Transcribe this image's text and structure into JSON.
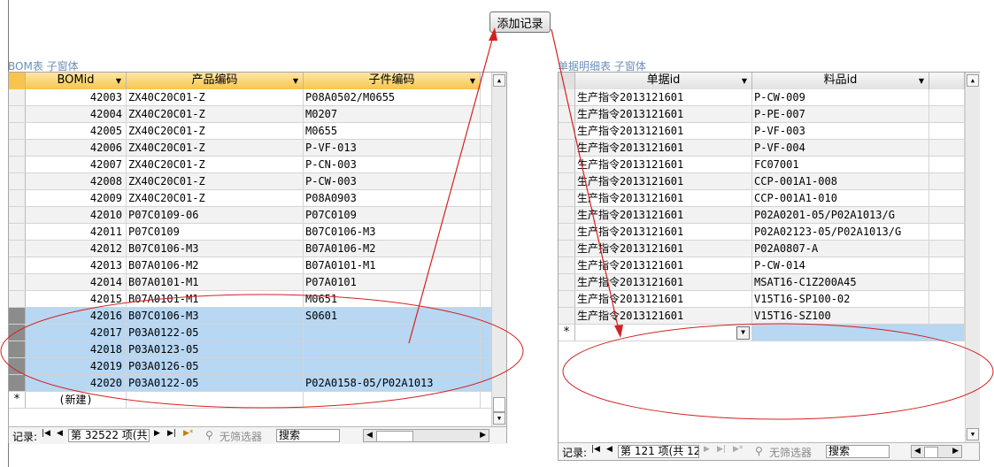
{
  "add_button_label": "添加记录",
  "bom": {
    "caption": "BOM表 子窗体",
    "columns": [
      "BOMid",
      "产品编码",
      "子件编码"
    ],
    "rows": [
      [
        "42003",
        "ZX40C20C01-Z",
        "P08A0502/M0655"
      ],
      [
        "42004",
        "ZX40C20C01-Z",
        "M0207"
      ],
      [
        "42005",
        "ZX40C20C01-Z",
        "M0655"
      ],
      [
        "42006",
        "ZX40C20C01-Z",
        "P-VF-013"
      ],
      [
        "42007",
        "ZX40C20C01-Z",
        "P-CN-003"
      ],
      [
        "42008",
        "ZX40C20C01-Z",
        "P-CW-003"
      ],
      [
        "42009",
        "ZX40C20C01-Z",
        "P08A0903"
      ],
      [
        "42010",
        "P07C0109-06",
        "P07C0109"
      ],
      [
        "42011",
        "P07C0109",
        "B07C0106-M3"
      ],
      [
        "42012",
        "B07C0106-M3",
        "B07A0106-M2"
      ],
      [
        "42013",
        "B07A0106-M2",
        "B07A0101-M1"
      ],
      [
        "42014",
        "B07A0101-M1",
        "P07A0101"
      ],
      [
        "42015",
        "B07A0101-M1",
        "M0651"
      ],
      [
        "42016",
        "B07C0106-M3",
        "S0601"
      ],
      [
        "42017",
        "P03A0122-05",
        ""
      ],
      [
        "42018",
        "P03A0123-05",
        ""
      ],
      [
        "42019",
        "P03A0126-05",
        ""
      ],
      [
        "42020",
        "P03A0122-05",
        "P02A0158-05/P02A1013"
      ]
    ],
    "new_row_marker": "*",
    "new_row_label": "(新建)",
    "nav_label": "记录:",
    "nav_position": "第 32522 项(共",
    "filter_label": "无筛选器",
    "search_label": "搜索"
  },
  "detail": {
    "caption": "单据明细表 子窗体",
    "columns": [
      "单据id",
      "料品id"
    ],
    "rows": [
      [
        "生产指令2013121601",
        "P-CW-009"
      ],
      [
        "生产指令2013121601",
        "P-PE-007"
      ],
      [
        "生产指令2013121601",
        "P-VF-003"
      ],
      [
        "生产指令2013121601",
        "P-VF-004"
      ],
      [
        "生产指令2013121601",
        "FC07001"
      ],
      [
        "生产指令2013121601",
        "CCP-001A1-008"
      ],
      [
        "生产指令2013121601",
        "CCP-001A1-010"
      ],
      [
        "生产指令2013121601",
        "P02A0201-05/P02A1013/G"
      ],
      [
        "生产指令2013121601",
        "P02A02123-05/P02A1013/G"
      ],
      [
        "生产指令2013121601",
        "P02A0807-A"
      ],
      [
        "生产指令2013121601",
        "P-CW-014"
      ],
      [
        "生产指令2013121601",
        "MSAT16-C1Z200A45"
      ],
      [
        "生产指令2013121601",
        "V15T16-SP100-02"
      ],
      [
        "生产指令2013121601",
        "V15T16-SZ100"
      ]
    ],
    "new_row_marker": "*",
    "nav_label": "记录:",
    "nav_position": "第 121 项(共 12",
    "filter_label": "无筛选器",
    "search_label": "搜索"
  },
  "colors": {
    "annotation": "#d42020",
    "header_gold": "#f7c54d",
    "selection": "#b7d7f3"
  }
}
